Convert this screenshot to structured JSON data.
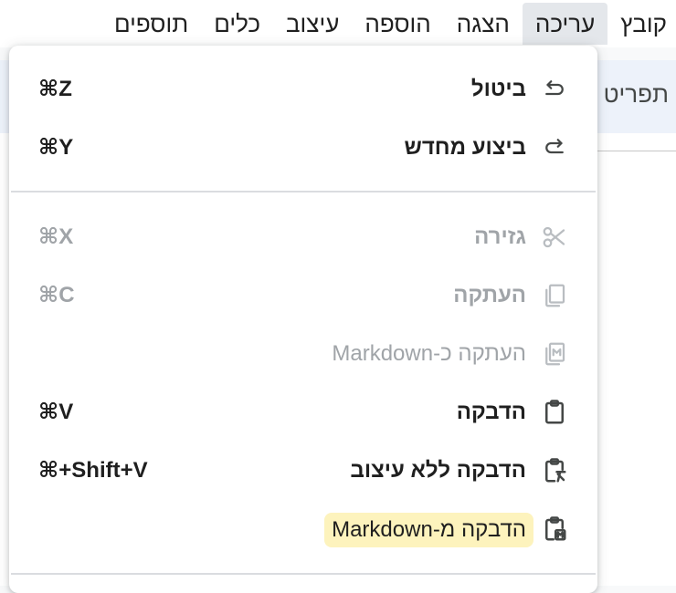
{
  "menubar": {
    "items": [
      "קובץ",
      "עריכה",
      "הצגה",
      "הוספה",
      "עיצוב",
      "כלים",
      "תוספים"
    ],
    "active_index": 1
  },
  "background": {
    "toolbar_partial_text": "תפריט"
  },
  "edit_menu": {
    "items": [
      {
        "label": "ביטול",
        "shortcut": "⌘Z",
        "icon": "undo-icon",
        "enabled": true
      },
      {
        "label": "ביצוע מחדש",
        "shortcut": "⌘Y",
        "icon": "redo-icon",
        "enabled": true
      },
      {
        "label": "גזירה",
        "shortcut": "⌘X",
        "icon": "scissors-icon",
        "enabled": false
      },
      {
        "label": "העתקה",
        "shortcut": "⌘C",
        "icon": "copy-icon",
        "enabled": false
      },
      {
        "label": "העתקה כ-Markdown",
        "shortcut": "",
        "icon": "copy-markdown-icon",
        "enabled": false
      },
      {
        "label": "הדבקה",
        "shortcut": "⌘V",
        "icon": "clipboard-icon",
        "enabled": true
      },
      {
        "label": "הדבקה ללא עיצוב",
        "shortcut": "⌘+Shift+V",
        "icon": "clipboard-clear-format-icon",
        "enabled": true
      },
      {
        "label": "הדבקה מ-Markdown",
        "shortcut": "",
        "icon": "clipboard-markdown-icon",
        "enabled": true,
        "highlighted": true
      }
    ]
  },
  "colors": {
    "enabled_text": "#1f1f1f",
    "disabled_text": "#a0a4a8",
    "highlight": "#fdf3bd",
    "active_menu_bg": "#e4e7eb"
  }
}
